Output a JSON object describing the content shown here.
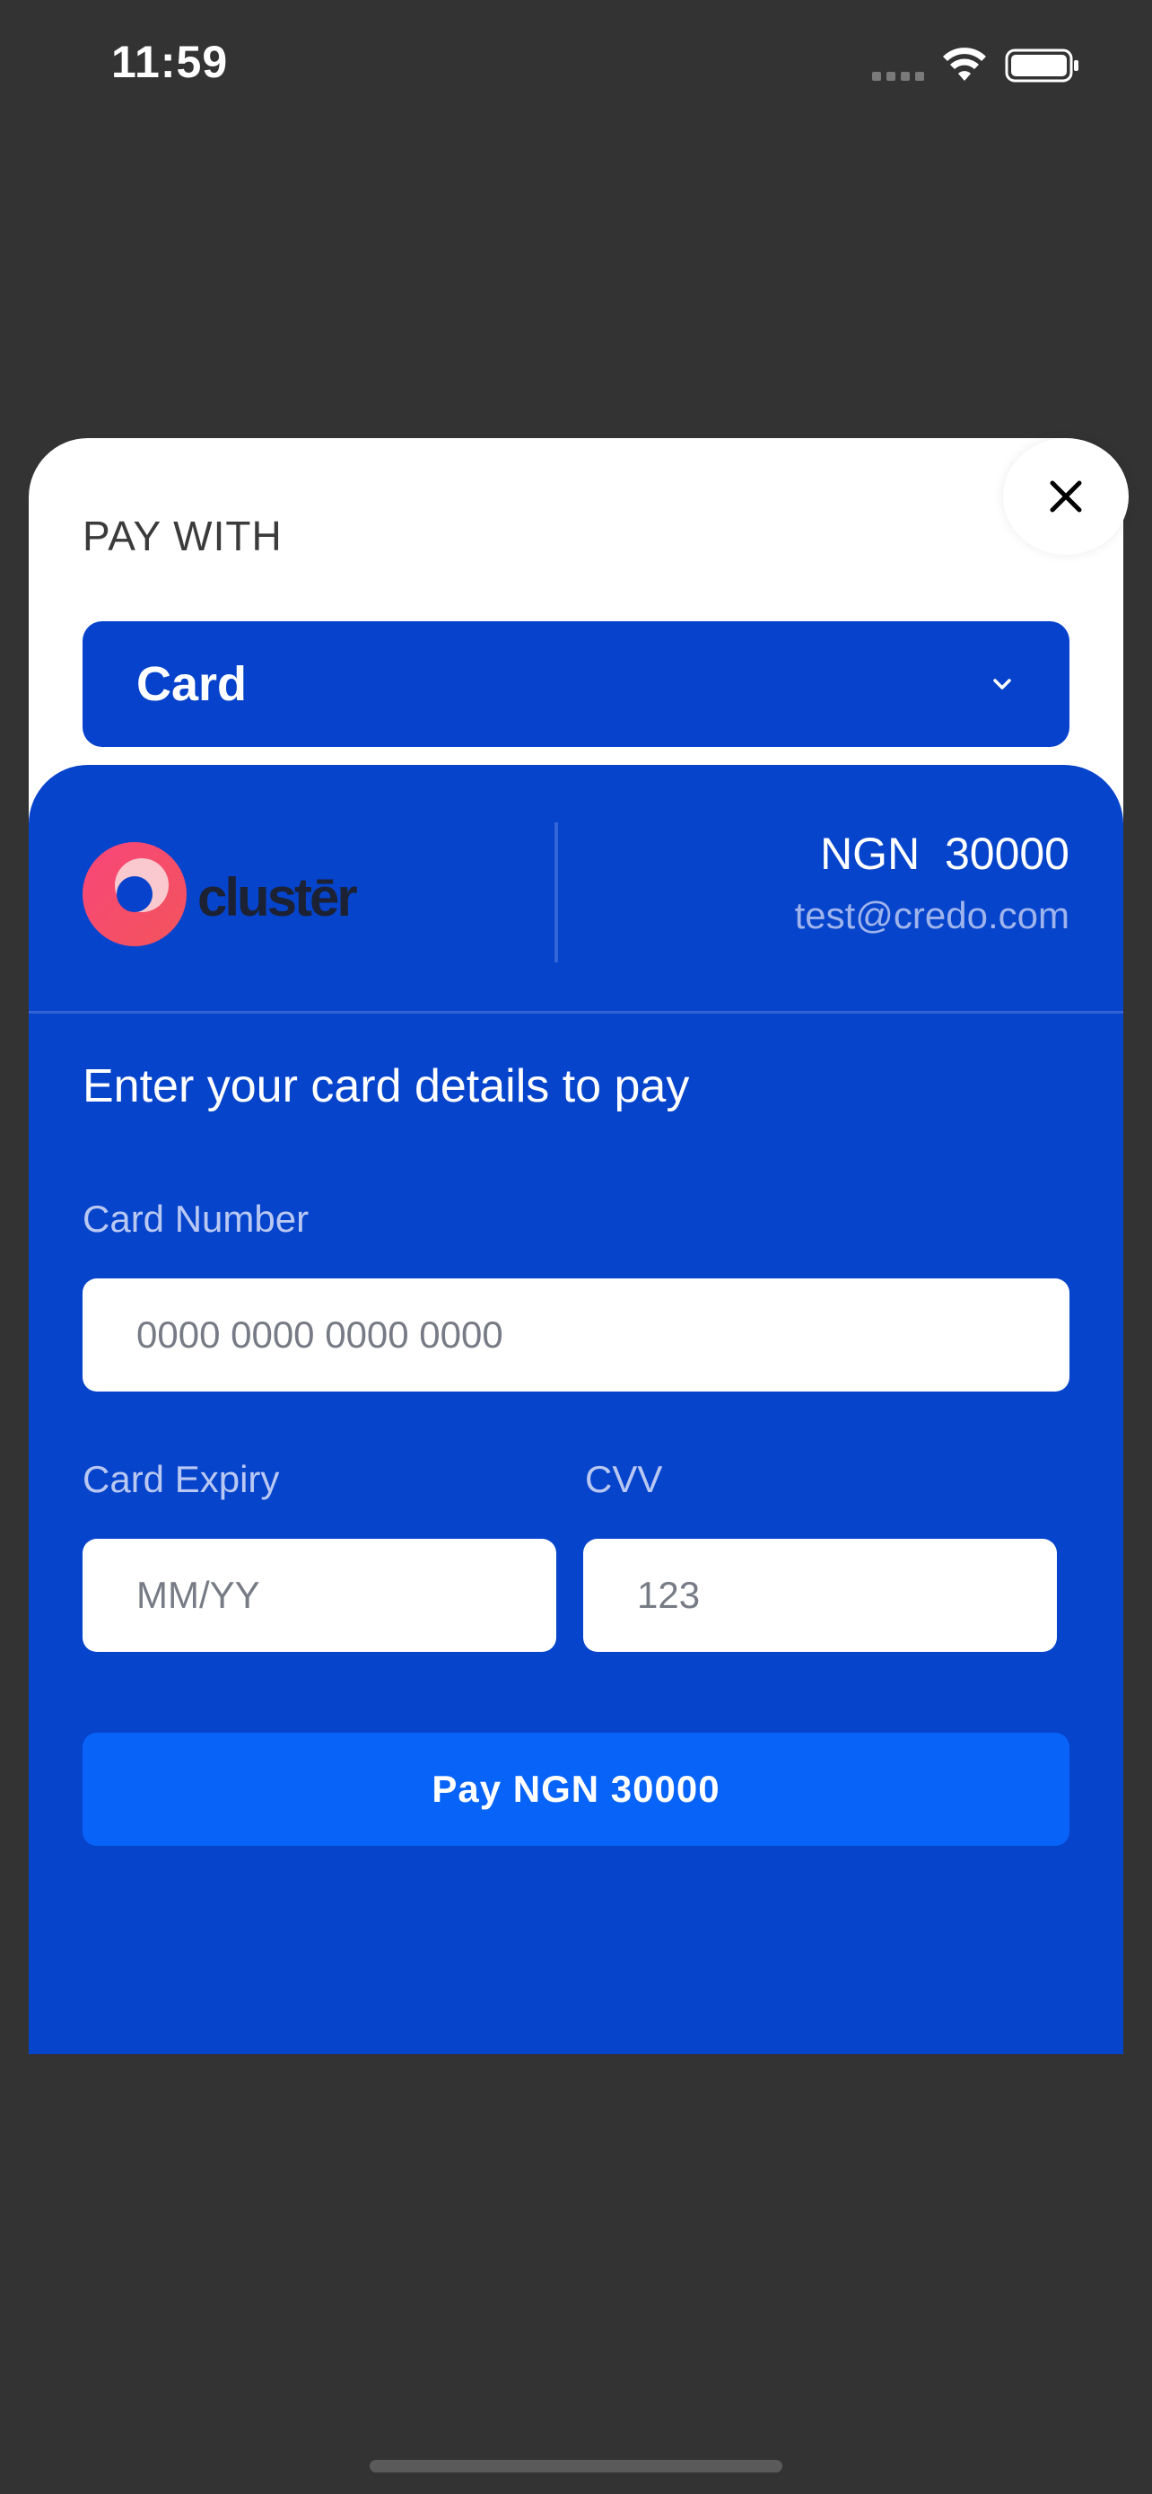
{
  "status_bar": {
    "time": "11:59",
    "icons": [
      "cellular-signal-icon",
      "wifi-icon",
      "battery-icon"
    ]
  },
  "sheet": {
    "close_icon": "close-icon",
    "pay_with_label": "PAY WITH",
    "payment_method": {
      "selected": "Card",
      "icon": "chevron-down-icon"
    }
  },
  "merchant": {
    "logo_text": "clustēr",
    "amount": "NGN  30000",
    "email": "test@credo.com"
  },
  "form": {
    "instruction": "Enter your card details to pay",
    "card_number": {
      "label": "Card Number",
      "placeholder": "0000 0000 0000 0000",
      "value": ""
    },
    "card_expiry": {
      "label": "Card Expiry",
      "placeholder": "MM/YY",
      "value": ""
    },
    "cvv": {
      "label": "CVV",
      "placeholder": "123",
      "value": ""
    },
    "pay_button_label": "Pay NGN 30000"
  },
  "colors": {
    "background": "#333333",
    "sheet": "#ffffff",
    "primary_blue": "#0644cb",
    "pay_button": "#0863f9",
    "logo_red": "#f43f5e"
  }
}
